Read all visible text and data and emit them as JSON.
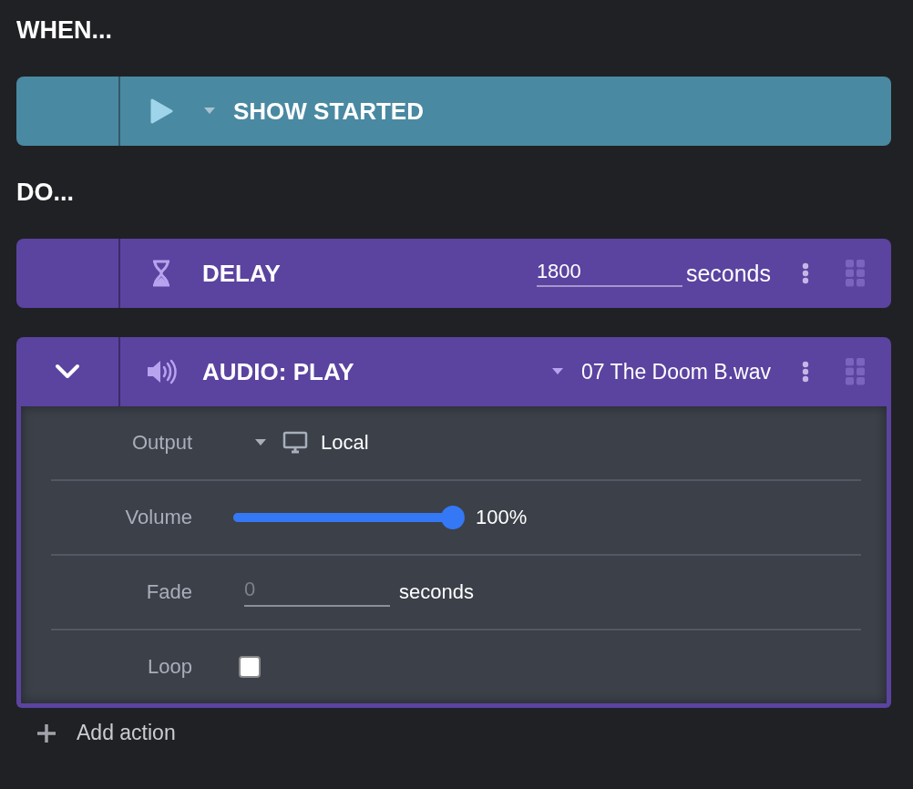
{
  "when": {
    "heading": "WHEN...",
    "trigger": {
      "kind": "show",
      "label": "SHOW STARTED"
    }
  },
  "do": {
    "heading": "DO...",
    "actions": [
      {
        "kind": "delay",
        "title": "DELAY",
        "value": "1800",
        "unit": "seconds",
        "expanded": false
      },
      {
        "kind": "audio",
        "title": "AUDIO: PLAY",
        "file": "07 The Doom B.wav",
        "expanded": true,
        "settings": [
          {
            "kind": "select",
            "label": "Output",
            "value": "Local"
          },
          {
            "kind": "slider",
            "label": "Volume",
            "level": 1,
            "reading": "100%"
          },
          {
            "kind": "number",
            "label": "Fade",
            "placeholder": "0",
            "unit": "seconds"
          },
          {
            "kind": "checkbox",
            "label": "Loop",
            "checked": false
          }
        ]
      }
    ]
  },
  "add_action": "Add action"
}
